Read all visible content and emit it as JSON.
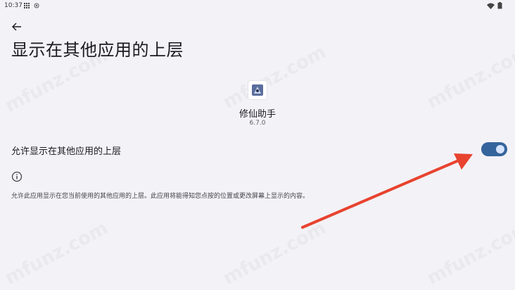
{
  "status_bar": {
    "time": "10:37"
  },
  "header": {
    "title": "显示在其他应用的上层"
  },
  "app": {
    "name": "修仙助手",
    "version": "6.7.0"
  },
  "setting": {
    "label": "允许显示在其他应用的上层",
    "enabled": true
  },
  "info": {
    "description": "允许此应用显示在您当前使用的其他应用的上层。此应用将能得知您点按的位置或更改屏幕上显示的内容。"
  },
  "watermark": {
    "text": "mfunz.com"
  },
  "colors": {
    "background": "#f3f2f7",
    "toggle_on": "#35649c",
    "annotation_arrow": "#e8432f"
  }
}
